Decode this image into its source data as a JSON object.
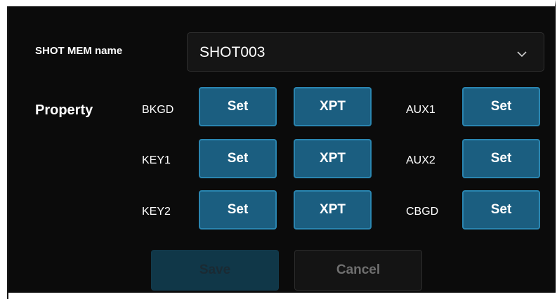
{
  "shot_mem": {
    "label": "SHOT MEM name",
    "selected_value": "SHOT003",
    "dropdown_icon": "chevron-down-icon"
  },
  "property": {
    "label": "Property",
    "rows": [
      {
        "label": "BKGD",
        "set_label": "Set",
        "xpt_label": "XPT",
        "aux_label": "AUX1",
        "aux_set_label": "Set"
      },
      {
        "label": "KEY1",
        "set_label": "Set",
        "xpt_label": "XPT",
        "aux_label": "AUX2",
        "aux_set_label": "Set"
      },
      {
        "label": "KEY2",
        "set_label": "Set",
        "xpt_label": "XPT",
        "aux_label": "CBGD",
        "aux_set_label": "Set"
      }
    ]
  },
  "actions": {
    "save_label": "Save",
    "cancel_label": "Cancel"
  },
  "colors": {
    "background": "#0b0b0b",
    "button_blue": "#1b5e80",
    "button_border": "#2a85b0",
    "save_disabled": "#103748"
  }
}
